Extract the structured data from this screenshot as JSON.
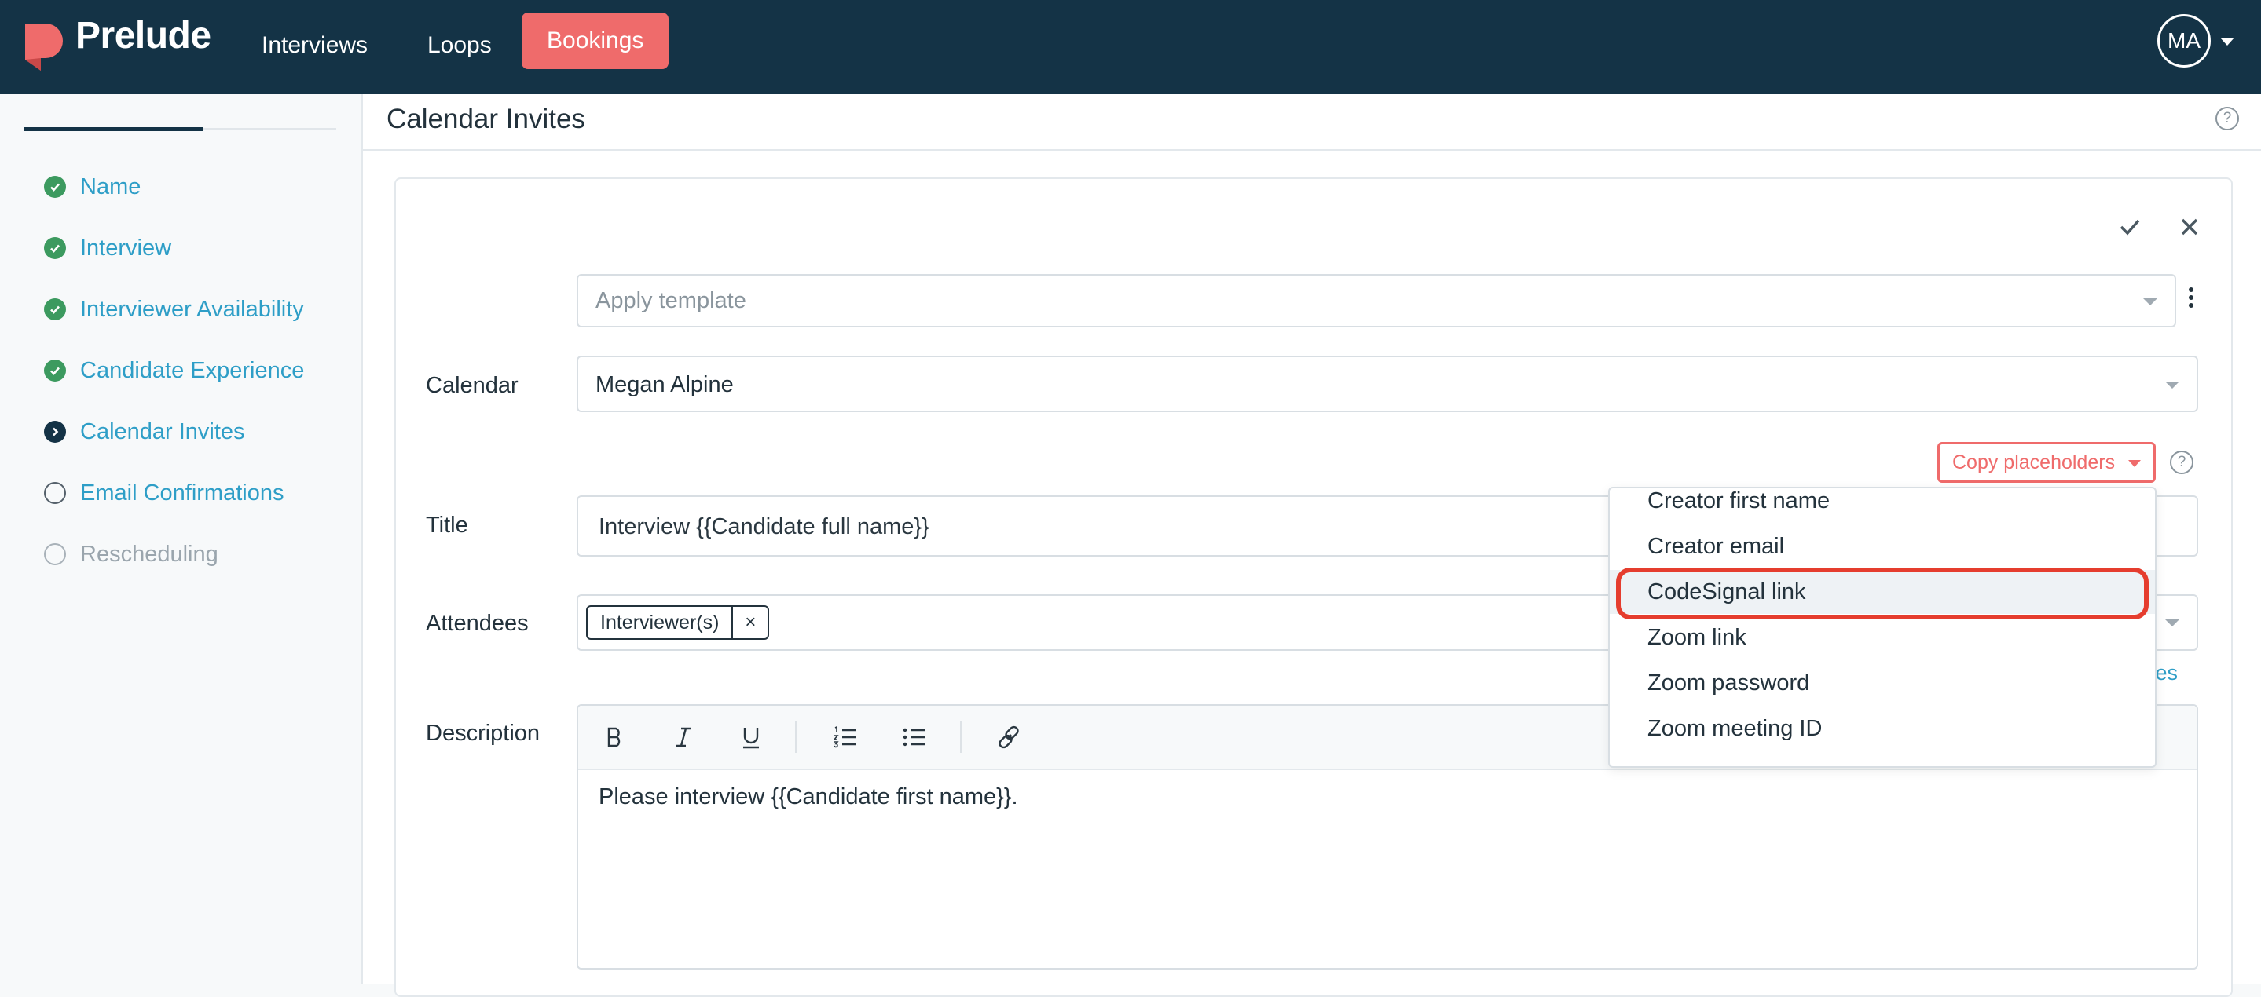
{
  "app": {
    "brand": "Prelude",
    "colors": {
      "navbar": "#143346",
      "accent": "#ef6b6b",
      "link": "#2e9ec7",
      "success": "#3c9a5f",
      "highlight_ring": "#e53d2e"
    }
  },
  "nav": {
    "items": [
      {
        "label": "Interviews",
        "active": false
      },
      {
        "label": "Loops",
        "active": false
      },
      {
        "label": "Bookings",
        "active": true
      }
    ],
    "user_initials": "MA"
  },
  "sidebar": {
    "progress": 0.57,
    "steps": [
      {
        "label": "Name",
        "status": "done",
        "icon": "check-circle-icon"
      },
      {
        "label": "Interview",
        "status": "done",
        "icon": "check-circle-icon"
      },
      {
        "label": "Interviewer Availability",
        "status": "done",
        "icon": "check-circle-icon"
      },
      {
        "label": "Candidate Experience",
        "status": "done",
        "icon": "check-circle-icon"
      },
      {
        "label": "Calendar Invites",
        "status": "current",
        "icon": "chevron-right-circle-icon"
      },
      {
        "label": "Email Confirmations",
        "status": "todo",
        "icon": "empty-circle-icon"
      },
      {
        "label": "Rescheduling",
        "status": "disabled",
        "icon": "empty-circle-icon"
      }
    ]
  },
  "page": {
    "title": "Calendar Invites",
    "help_glyph": "?"
  },
  "form": {
    "template_placeholder": "Apply template",
    "calendar": {
      "label": "Calendar",
      "value": "Megan Alpine"
    },
    "copy_placeholders_label": "Copy placeholders",
    "title": {
      "label": "Title",
      "value": "Interview {{Candidate full name}}"
    },
    "attendees": {
      "label": "Attendees",
      "chips": [
        {
          "label": "Interviewer(s)",
          "remove_glyph": "×"
        }
      ]
    },
    "attendees_link_fragment": "es",
    "description": {
      "label": "Description",
      "toolbar": [
        "bold-icon",
        "italic-icon",
        "underline-icon",
        "ordered-list-icon",
        "bullet-list-icon",
        "link-icon"
      ],
      "value": "Please interview {{Candidate first name}}."
    }
  },
  "dropdown": {
    "items": [
      {
        "label": "Creator first name",
        "highlighted": false
      },
      {
        "label": "Creator email",
        "highlighted": false
      },
      {
        "label": "CodeSignal link",
        "highlighted": true
      },
      {
        "label": "Zoom link",
        "highlighted": false
      },
      {
        "label": "Zoom password",
        "highlighted": false
      },
      {
        "label": "Zoom meeting ID",
        "highlighted": false
      }
    ]
  }
}
